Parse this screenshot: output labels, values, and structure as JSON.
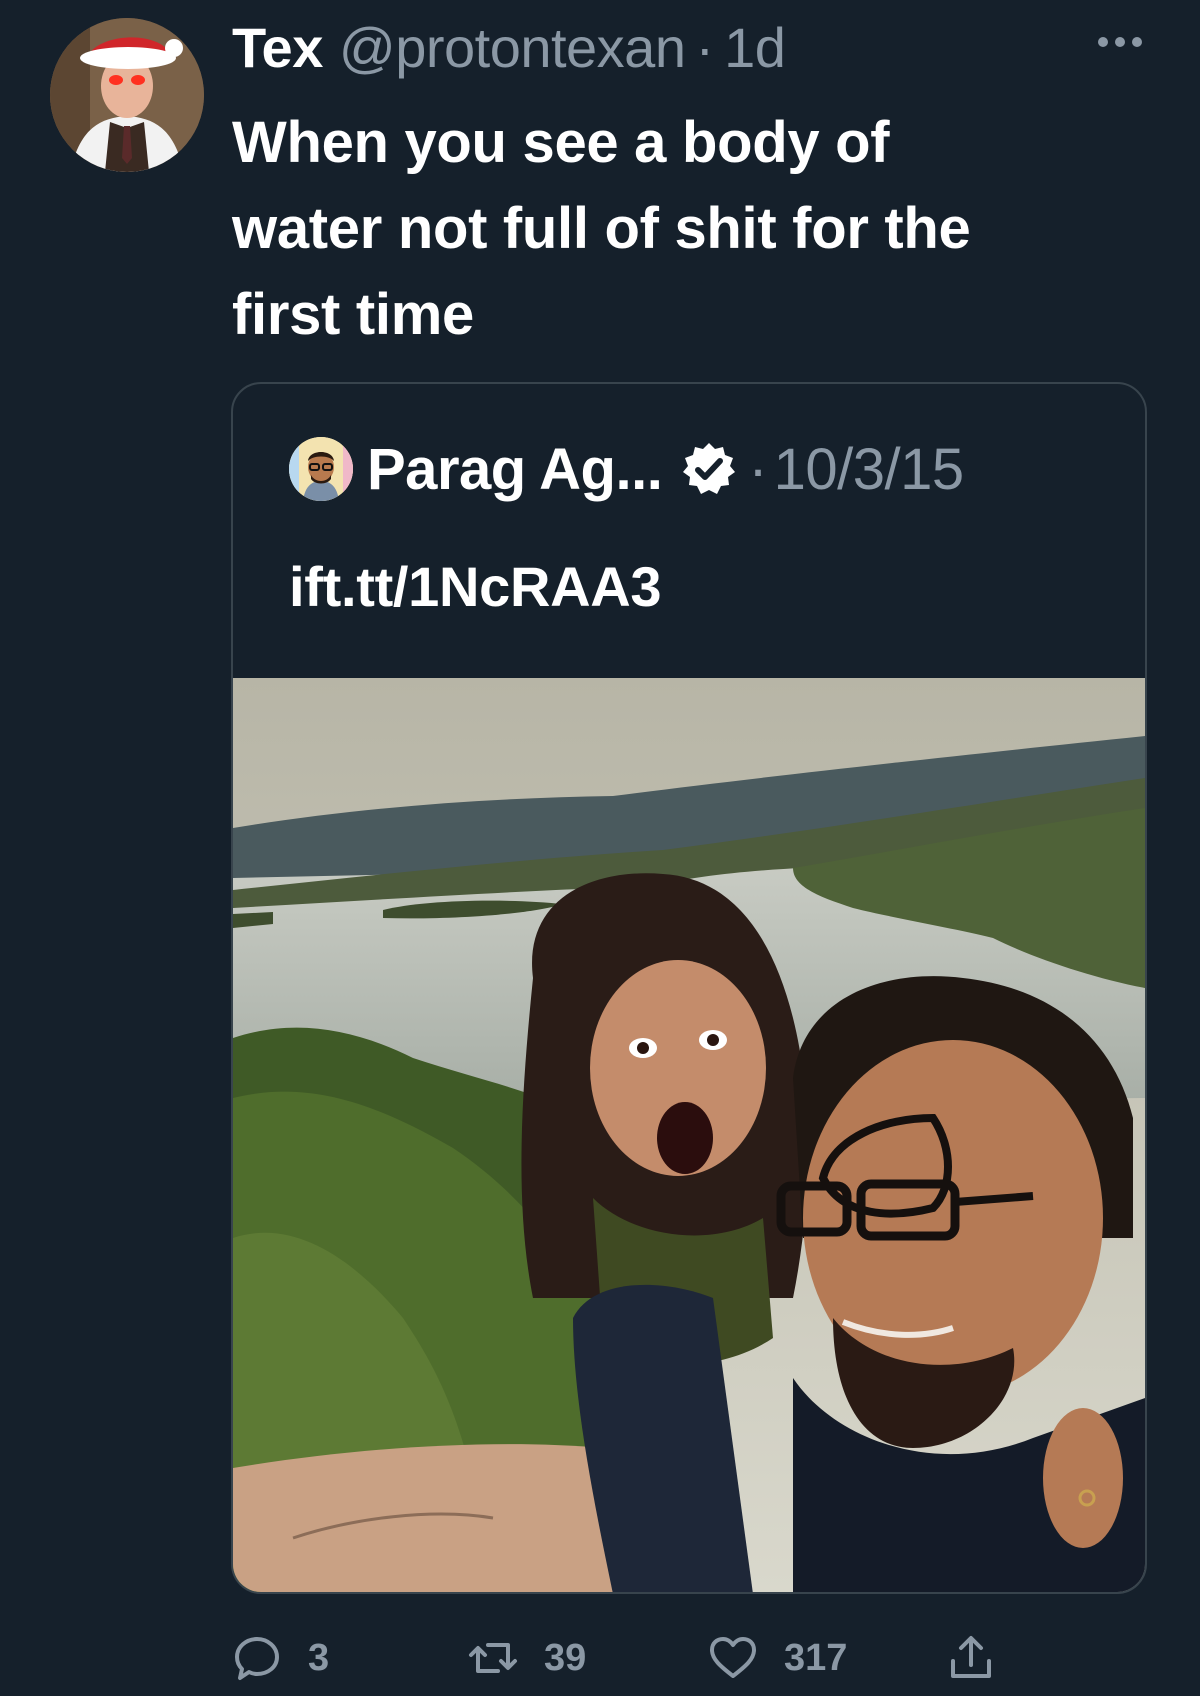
{
  "tweet": {
    "display_name": "Tex",
    "handle": "@protontexan",
    "separator": "·",
    "time": "1d",
    "text_lines": [
      "When you see a body of",
      "water not full of shit for the",
      "first time"
    ]
  },
  "quote": {
    "display_name": "Parag Ag...",
    "separator": "·",
    "date": "10/3/15",
    "text": "ift.tt/1NcRAA3"
  },
  "actions": {
    "replies": "3",
    "retweets": "39",
    "likes": "317"
  },
  "colors": {
    "background": "#15202b",
    "secondary_text": "#8b98a5",
    "border": "#38444d"
  },
  "icons": [
    "more-icon",
    "verified-icon",
    "reply-icon",
    "retweet-icon",
    "like-icon",
    "share-icon"
  ]
}
